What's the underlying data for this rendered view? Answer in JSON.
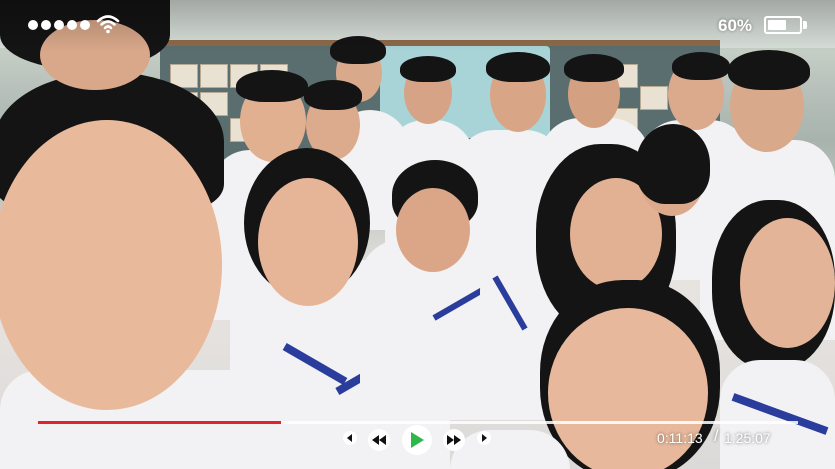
{
  "status_bar": {
    "battery_percent_label": "60%",
    "battery_level": 0.6,
    "signal_strength_dots": 5,
    "wifi_icon": "wifi-icon"
  },
  "player": {
    "elapsed_time": "0:11:13",
    "separator": "/",
    "total_time": "1:25:07",
    "progress": 0.32,
    "progress_color": "#e0242b",
    "controls": [
      {
        "name": "previous-frame-icon"
      },
      {
        "name": "rewind-icon"
      },
      {
        "name": "play-icon",
        "color": "#2fb84a"
      },
      {
        "name": "fast-forward-icon"
      },
      {
        "name": "next-frame-icon"
      }
    ]
  }
}
